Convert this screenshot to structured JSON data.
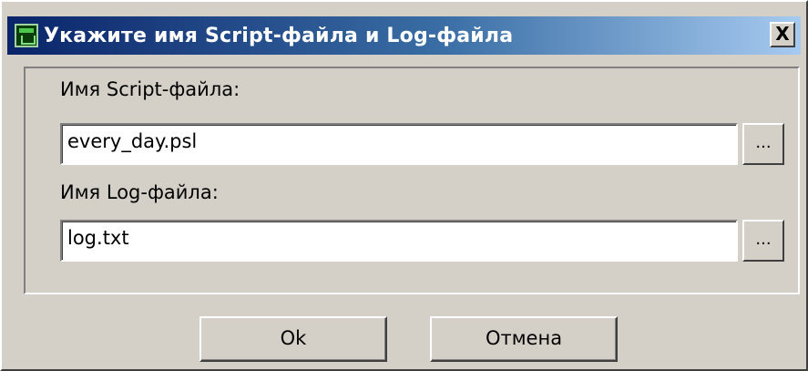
{
  "dialog": {
    "title": "Укажите имя Script-файла и Log-файла",
    "close_label": "X"
  },
  "script_file": {
    "label": "Имя Script-файла:",
    "value": "every_day.psl",
    "browse_label": "..."
  },
  "log_file": {
    "label": "Имя Log-файла:",
    "value": "log.txt",
    "browse_label": "..."
  },
  "buttons": {
    "ok_label": "Ok",
    "cancel_label": "Отмена"
  }
}
